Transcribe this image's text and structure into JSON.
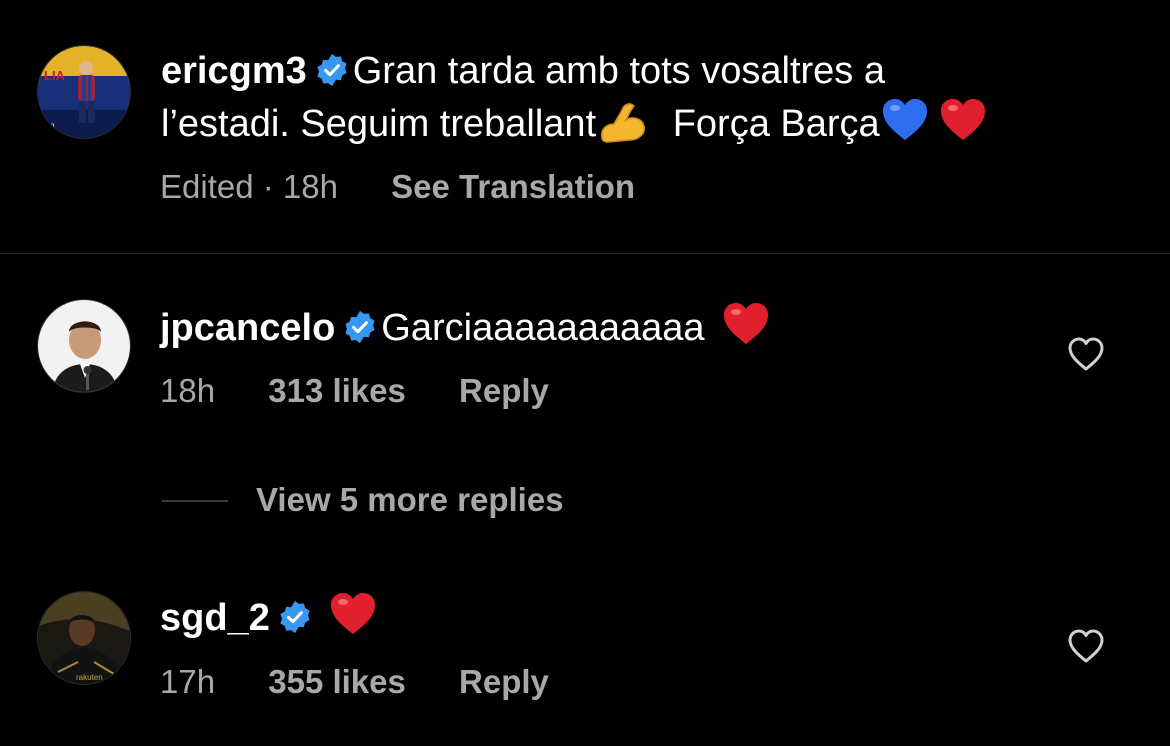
{
  "caption": {
    "username": "ericgm3",
    "text_line1": "Gran tarda amb tots vosaltres a",
    "text_line2": "l’estadi. Seguim treballant",
    "text_line2b": "Força Barça",
    "edited": "Edited",
    "time": "18h",
    "translate": "See Translation",
    "avatar_icon": "profile-photo-player-in-barca-kit"
  },
  "comments": [
    {
      "username": "jpcancelo",
      "text": "Garciaaaaaaaaaaa",
      "time": "18h",
      "likes": "313 likes",
      "reply": "Reply",
      "avatar_icon": "profile-photo-man-at-microphone"
    },
    {
      "username": "sgd_2",
      "text": "",
      "time": "17h",
      "likes": "355 likes",
      "reply": "Reply",
      "avatar_icon": "profile-photo-player-black-kit"
    }
  ],
  "view_replies": "View 5 more replies",
  "colors": {
    "background": "#000000",
    "text": "#ffffff",
    "secondary": "#a8a8a8",
    "verified": "#3897f0",
    "heart_red": "#e0202e",
    "heart_blue": "#2f6df0"
  }
}
